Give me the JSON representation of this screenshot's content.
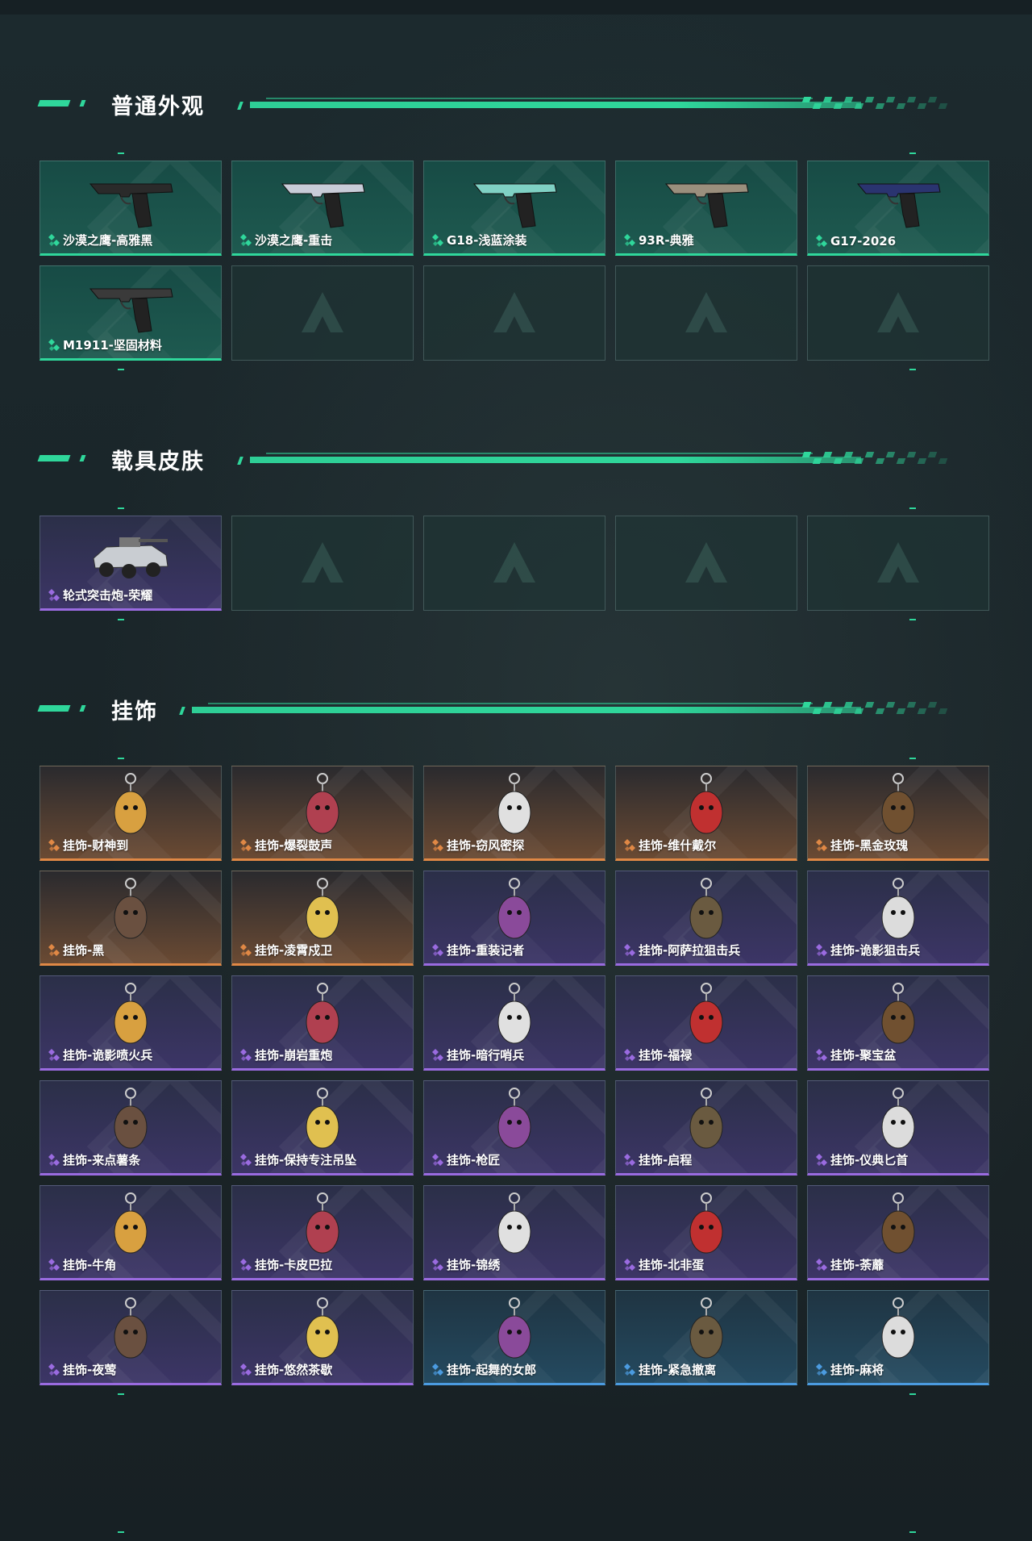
{
  "colors": {
    "accent": "#2fd79b",
    "purple": "#9a6be0",
    "orange": "#e08845",
    "blue": "#4b9be0"
  },
  "sections": [
    {
      "title": "普通外观",
      "items": [
        {
          "label": "沙漠之鹰-高雅黑",
          "rarity": "green",
          "icon": "pistol-icon"
        },
        {
          "label": "沙漠之鹰-重击",
          "rarity": "green",
          "icon": "pistol-icon"
        },
        {
          "label": "G18-浅蓝涂装",
          "rarity": "green",
          "icon": "pistol-icon"
        },
        {
          "label": "93R-典雅",
          "rarity": "green",
          "icon": "pistol-icon"
        },
        {
          "label": "G17-2026",
          "rarity": "green",
          "icon": "pistol-icon"
        },
        {
          "label": "M1911-坚固材料",
          "rarity": "green",
          "icon": "pistol-icon"
        },
        null,
        null,
        null,
        null
      ]
    },
    {
      "title": "载具皮肤",
      "items": [
        {
          "label": "轮式突击炮-荣耀",
          "rarity": "purple",
          "icon": "vehicle-icon"
        },
        null,
        null,
        null,
        null
      ]
    },
    {
      "title": "挂饰",
      "items": [
        {
          "label": "挂饰-财神到",
          "rarity": "orange",
          "icon": "charm-icon"
        },
        {
          "label": "挂饰-爆裂鼓声",
          "rarity": "orange",
          "icon": "charm-icon"
        },
        {
          "label": "挂饰-窃风密探",
          "rarity": "orange",
          "icon": "charm-icon"
        },
        {
          "label": "挂饰-维什戴尔",
          "rarity": "orange",
          "icon": "charm-icon"
        },
        {
          "label": "挂饰-黑金玫瑰",
          "rarity": "orange",
          "icon": "charm-icon"
        },
        {
          "label": "挂饰-黑",
          "rarity": "orange",
          "icon": "charm-icon"
        },
        {
          "label": "挂饰-凌霄戍卫",
          "rarity": "orange",
          "icon": "charm-icon"
        },
        {
          "label": "挂饰-重装记者",
          "rarity": "purple",
          "icon": "charm-icon"
        },
        {
          "label": "挂饰-阿萨拉狙击兵",
          "rarity": "purple",
          "icon": "charm-icon"
        },
        {
          "label": "挂饰-诡影狙击兵",
          "rarity": "purple",
          "icon": "charm-icon"
        },
        {
          "label": "挂饰-诡影喷火兵",
          "rarity": "purple",
          "icon": "charm-icon"
        },
        {
          "label": "挂饰-崩岩重炮",
          "rarity": "purple",
          "icon": "charm-icon"
        },
        {
          "label": "挂饰-暗行哨兵",
          "rarity": "purple",
          "icon": "charm-icon"
        },
        {
          "label": "挂饰-福禄",
          "rarity": "purple",
          "icon": "charm-icon"
        },
        {
          "label": "挂饰-聚宝盆",
          "rarity": "purple",
          "icon": "charm-icon"
        },
        {
          "label": "挂饰-来点薯条",
          "rarity": "purple",
          "icon": "charm-icon"
        },
        {
          "label": "挂饰-保持专注吊坠",
          "rarity": "purple",
          "icon": "charm-icon"
        },
        {
          "label": "挂饰-枪匠",
          "rarity": "purple",
          "icon": "charm-icon"
        },
        {
          "label": "挂饰-启程",
          "rarity": "purple",
          "icon": "charm-icon"
        },
        {
          "label": "挂饰-仪典匕首",
          "rarity": "purple",
          "icon": "charm-icon"
        },
        {
          "label": "挂饰-牛角",
          "rarity": "purple",
          "icon": "charm-icon"
        },
        {
          "label": "挂饰-卡皮巴拉",
          "rarity": "purple",
          "icon": "charm-icon"
        },
        {
          "label": "挂饰-锦绣",
          "rarity": "purple",
          "icon": "charm-icon"
        },
        {
          "label": "挂饰-北非蛋",
          "rarity": "purple",
          "icon": "charm-icon"
        },
        {
          "label": "挂饰-荼蘼",
          "rarity": "purple",
          "icon": "charm-icon"
        },
        {
          "label": "挂饰-夜莺",
          "rarity": "purple",
          "icon": "charm-icon"
        },
        {
          "label": "挂饰-悠然茶歇",
          "rarity": "purple",
          "icon": "charm-icon"
        },
        {
          "label": "挂饰-起舞的女郎",
          "rarity": "blue",
          "icon": "charm-icon"
        },
        {
          "label": "挂饰-紧急撤离",
          "rarity": "blue",
          "icon": "charm-icon"
        },
        {
          "label": "挂饰-麻将",
          "rarity": "blue",
          "icon": "charm-icon"
        }
      ]
    }
  ]
}
